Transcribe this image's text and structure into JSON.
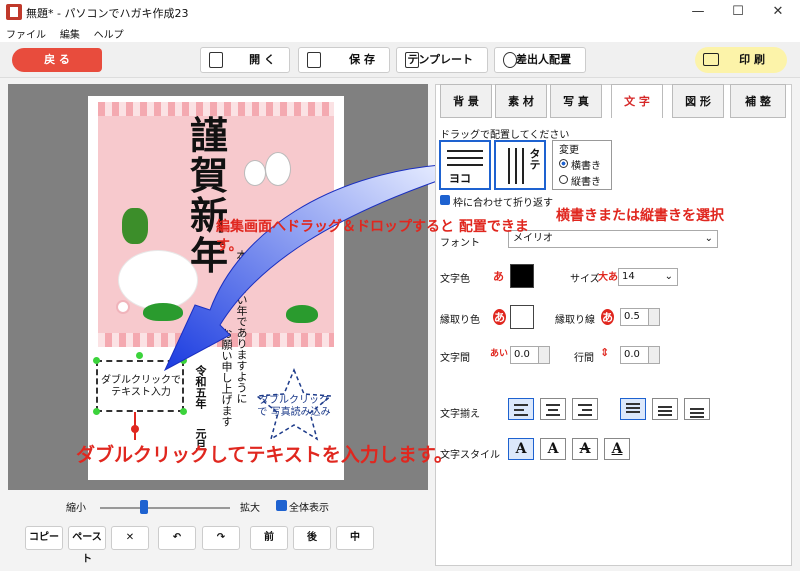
{
  "window": {
    "title": "無題* - パソコンでハガキ作成23",
    "minimize": "—",
    "maximize": "☐",
    "close": "✕"
  },
  "menu": [
    "ファイル",
    "編集",
    "ヘルプ"
  ],
  "toolbar": {
    "back": "戻 る",
    "open": "開 く",
    "save": "保 存",
    "template": "テンプレート",
    "sender": "差出人配置",
    "print": "印 刷"
  },
  "card": {
    "greeting_big": "謹賀新年",
    "vertical_message": "本年もよい年でありますように",
    "vertical_message2": "お願い申し上げます",
    "reiwa": "令和五年",
    "gantan": "元旦",
    "textbox_label": "ダブルクリックで テキスト入力",
    "photo_label": "ダブルクリックで 写真読み込み"
  },
  "zoom": {
    "out": "縮小",
    "in": "拡大",
    "show_all": "全体表示",
    "level_percent": 30
  },
  "bottom_buttons": [
    "コピー",
    "ペースト",
    "✕",
    "↶",
    "↷",
    "前",
    "後",
    "中"
  ],
  "tabs": [
    "背 景",
    "素 材",
    "写 真",
    "文 字",
    "図 形",
    "補 整"
  ],
  "active_tab": 3,
  "panel": {
    "drag_hint": "ドラッグで配置してください",
    "horizontal_icon_text": "ヨコ",
    "vertical_icon_text": "タテ",
    "change_label": "変更",
    "opt_horizontal": "横書き",
    "opt_vertical": "縦書き",
    "wrap_label": "枠に合わせて折り返す",
    "font_label": "フォント",
    "font_value": "メイリオ",
    "color_label": "文字色",
    "size_label": "サイズ",
    "size_value": "14",
    "outline_color_label": "縁取り色",
    "outline_line_label": "縁取り線",
    "outline_value": "0.5",
    "char_spacing_label": "文字間",
    "char_spacing_value": "0.0",
    "line_spacing_label": "行間",
    "line_spacing_value": "0.0",
    "align_label": "文字揃え",
    "style_label": "文字スタイル",
    "a_glyph": "あ"
  },
  "annotations": {
    "drag_drop": "編集画面へドラッグ＆ドロップすると 配置できます。",
    "select": "横書きまたは縦書きを選択",
    "double_click": "ダブルクリックしてテキストを入力します。"
  },
  "colors": {
    "accent_red": "#e0271f",
    "tab_active": "#d62828",
    "blue": "#1e62d0"
  }
}
